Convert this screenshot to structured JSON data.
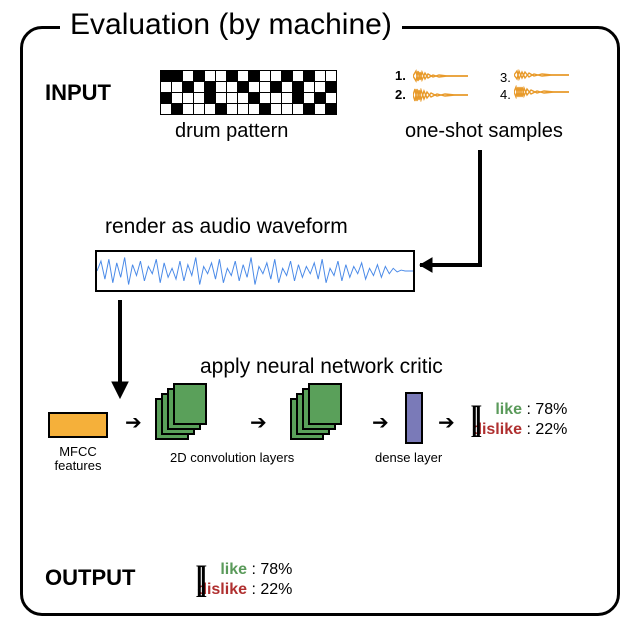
{
  "frame_title": "Evaluation (by machine)",
  "labels": {
    "input": "INPUT",
    "output": "OUTPUT",
    "drum_pattern": "drum pattern",
    "one_shot": "one-shot samples",
    "render": "render as audio waveform",
    "apply_nn": "apply neural network critic",
    "mfcc": "MFCC features",
    "conv": "2D convolution layers",
    "dense": "dense layer"
  },
  "samples": {
    "s1": "1.",
    "s2": "2.",
    "s3": "3.",
    "s4": "4."
  },
  "result": {
    "like_label": "like",
    "like_pct": ": 78%",
    "dislike_label": "dislike",
    "dislike_pct": ": 22%"
  },
  "drum_pattern_rows": [
    "1101001010010100",
    "0010100100101001",
    "1000100010001010",
    "0100010001000101"
  ],
  "chart_data": {
    "type": "diagram",
    "title": "Evaluation (by machine)",
    "pipeline": [
      {
        "stage": "input",
        "components": [
          "drum pattern (4x16 step sequencer grid)",
          "one-shot samples (4 audio clips)"
        ]
      },
      {
        "stage": "render",
        "description": "render as audio waveform"
      },
      {
        "stage": "features",
        "description": "MFCC features"
      },
      {
        "stage": "model",
        "layers": [
          "2D convolution layers",
          "2D convolution layers",
          "dense layer"
        ]
      },
      {
        "stage": "output",
        "like": 78,
        "dislike": 22,
        "unit": "%"
      }
    ],
    "output_distribution": {
      "like": 78,
      "dislike": 22
    }
  }
}
